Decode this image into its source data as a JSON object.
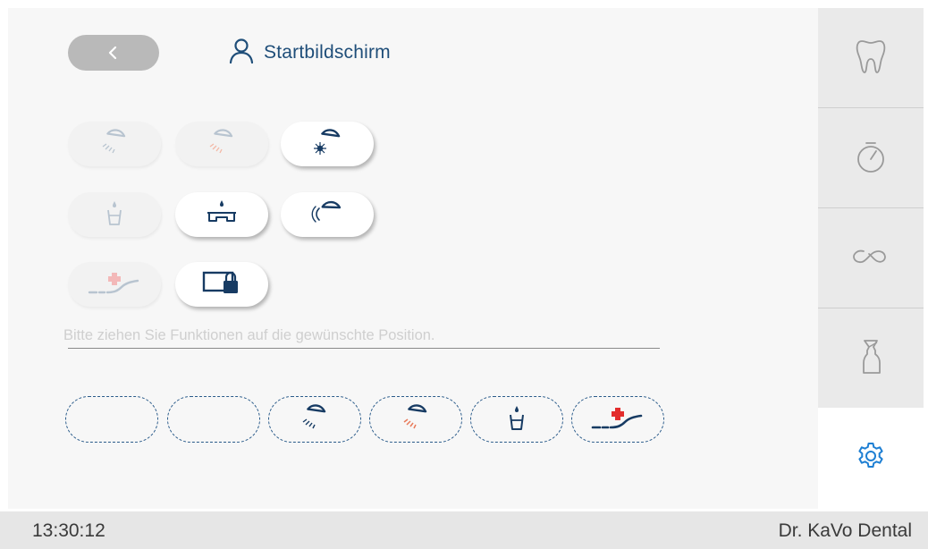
{
  "header": {
    "back_icon": "chevron-left-icon",
    "title": "Startbildschirm",
    "title_icon": "user-icon"
  },
  "functions": {
    "row1": [
      {
        "name": "light-dimmed",
        "icon": "operating-light-icon",
        "enabled": false
      },
      {
        "name": "light-warm",
        "icon": "operating-light-warm-icon",
        "enabled": false
      },
      {
        "name": "light-composite",
        "icon": "operating-light-composite-icon",
        "enabled": true
      }
    ],
    "row2": [
      {
        "name": "cup-filler",
        "icon": "cup-filler-icon",
        "enabled": false
      },
      {
        "name": "bowl-rinse",
        "icon": "bowl-rinse-icon",
        "enabled": true
      },
      {
        "name": "light-sensor",
        "icon": "light-sensor-icon",
        "enabled": true
      }
    ],
    "row3": [
      {
        "name": "emergency-position",
        "icon": "emergency-chair-icon",
        "enabled": false
      },
      {
        "name": "screen-lock",
        "icon": "screen-lock-icon",
        "enabled": true
      }
    ]
  },
  "hint_text": "Bitte ziehen Sie Funktionen auf die gewünschte Position.",
  "slots": [
    {
      "icon": ""
    },
    {
      "icon": ""
    },
    {
      "icon": "operating-light-icon"
    },
    {
      "icon": "operating-light-warm-icon"
    },
    {
      "icon": "cup-filler-icon"
    },
    {
      "icon": "emergency-chair-icon"
    }
  ],
  "sidebar": {
    "items": [
      {
        "name": "dental",
        "icon": "tooth-icon",
        "active": false
      },
      {
        "name": "timer",
        "icon": "stopwatch-icon",
        "active": false
      },
      {
        "name": "loop",
        "icon": "loop-icon",
        "active": false
      },
      {
        "name": "hygiene",
        "icon": "spray-bottle-icon",
        "active": false
      },
      {
        "name": "settings",
        "icon": "gear-icon",
        "active": true
      }
    ]
  },
  "status": {
    "time": "13:30:12",
    "user": "Dr. KaVo Dental"
  },
  "colors": {
    "accent": "#1f4e79",
    "primary_icon": "#173b63",
    "warm": "#e87a5a",
    "red_cross": "#e32d2d",
    "disabled_icon": "#b8c4d0",
    "active_gear": "#1e7fd3"
  }
}
